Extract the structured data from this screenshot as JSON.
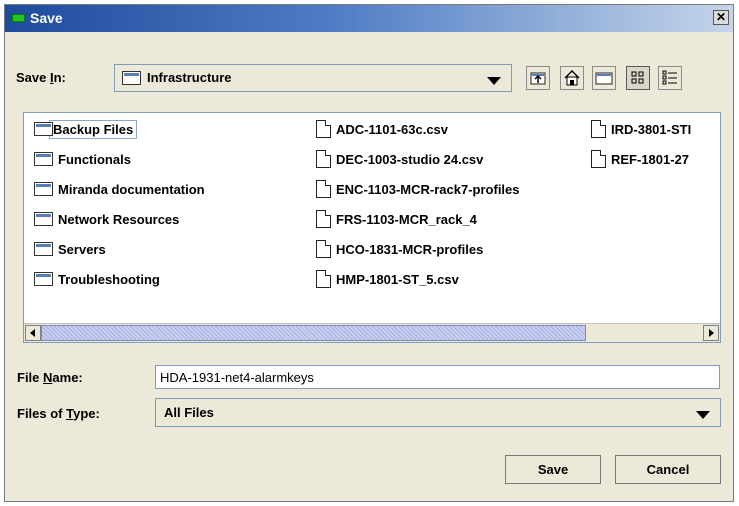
{
  "window": {
    "title": "Save",
    "close_glyph": "✕"
  },
  "save_in": {
    "label_pre": "Save ",
    "label_key": "I",
    "label_post": "n:",
    "value": "Infrastructure",
    "icon": "folder-icon"
  },
  "toolbar": {
    "buttons": [
      "up-one-level-icon",
      "home-icon",
      "new-folder-icon",
      "list-view-icon",
      "details-view-icon"
    ],
    "selected": "list-view-icon"
  },
  "files": {
    "folders": [
      "Backup Files",
      "Functionals",
      "Miranda documentation",
      "Network Resources",
      "Servers",
      "Troubleshooting"
    ],
    "files_col2": [
      "ADC-1101-63c.csv",
      "DEC-1003-studio 24.csv",
      "ENC-1103-MCR-rack7-profiles",
      "FRS-1103-MCR_rack_4",
      "HCO-1831-MCR-profiles",
      "HMP-1801-ST_5.csv"
    ],
    "files_col3": [
      "IRD-3801-STI",
      "REF-1801-27"
    ],
    "selected": "Backup Files"
  },
  "file_name": {
    "label_pre": "File ",
    "label_key": "N",
    "label_post": "ame:",
    "value": "HDA-1931-net4-alarmkeys"
  },
  "file_type": {
    "label_pre": "Files of ",
    "label_key": "T",
    "label_post": "ype:",
    "value": "All Files"
  },
  "buttons": {
    "save": "Save",
    "cancel": "Cancel"
  }
}
